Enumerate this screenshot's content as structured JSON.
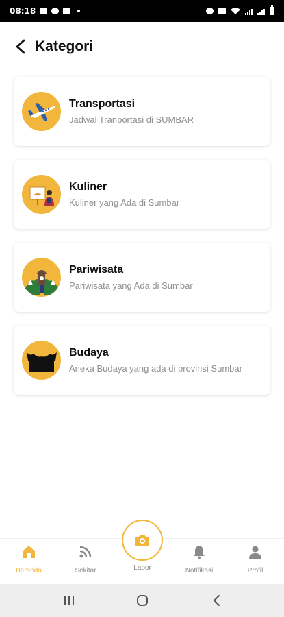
{
  "status_bar": {
    "time": "08:18",
    "icons": [
      "image-icon",
      "whatsapp-icon",
      "instagram-icon",
      "alarm-icon",
      "mute-icon",
      "wifi-icon",
      "signal-icon",
      "battery-icon"
    ]
  },
  "header": {
    "title": "Kategori",
    "back_icon": "chevron-left-icon"
  },
  "categories": [
    {
      "title": "Transportasi",
      "subtitle": "Jadwal Tranportasi di SUMBAR",
      "icon": "airplane-icon"
    },
    {
      "title": "Kuliner",
      "subtitle": "Kuliner yang Ada di Sumbar",
      "icon": "chef-icon"
    },
    {
      "title": "Pariwisata",
      "subtitle": "Pariwisata yang Ada di Sumbar",
      "icon": "monument-icon"
    },
    {
      "title": "Budaya",
      "subtitle": "Aneka Budaya yang ada di provinsi Sumbar",
      "icon": "rumah-gadang-icon"
    }
  ],
  "bottom_nav": {
    "items": [
      {
        "label": "Beranda",
        "icon": "home-icon",
        "active": true
      },
      {
        "label": "Sekitar",
        "icon": "rss-icon",
        "active": false
      },
      {
        "label": "Lapor",
        "icon": "camera-icon",
        "active": false
      },
      {
        "label": "Notifikasi",
        "icon": "bell-icon",
        "active": false
      },
      {
        "label": "Profil",
        "icon": "person-icon",
        "active": false
      }
    ]
  },
  "colors": {
    "accent": "#f2b63c",
    "inactive": "#8a8a8a",
    "subtitle": "#8f8f8f"
  }
}
